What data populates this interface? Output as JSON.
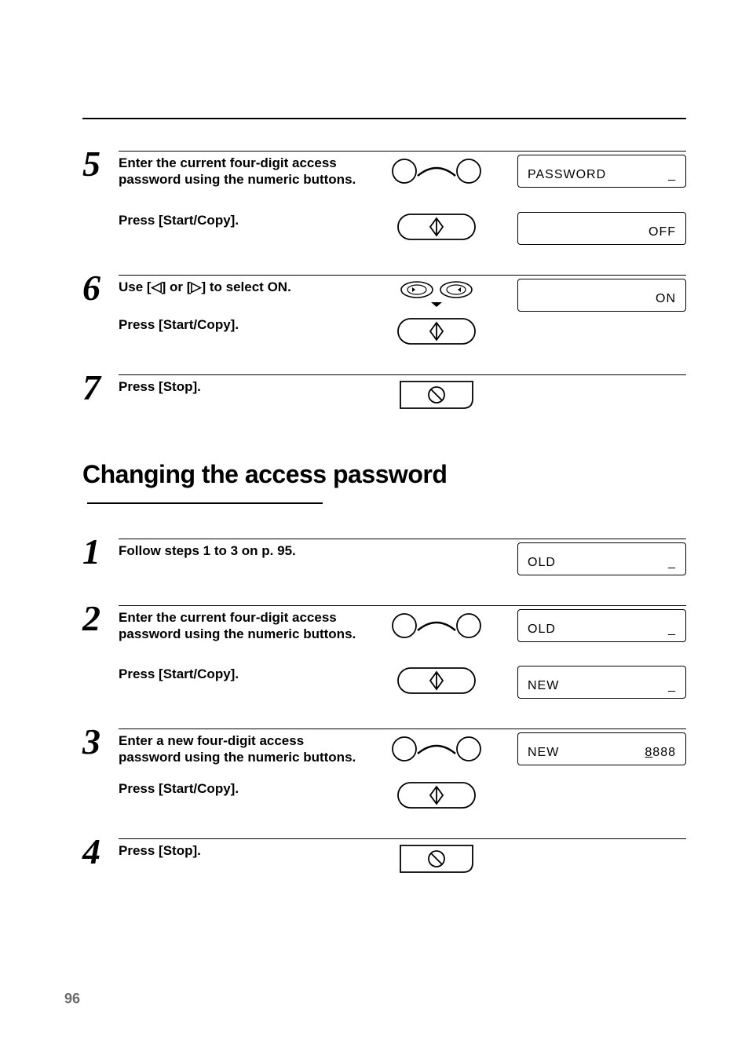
{
  "section1": {
    "step5": {
      "num": "5",
      "instr1": "Enter the current four-digit access password using the numeric buttons.",
      "disp1_left": "PASSWORD",
      "disp1_right": "_",
      "instr2": "Press [Start/Copy].",
      "disp2_right": "OFF"
    },
    "step6": {
      "num": "6",
      "instr1": "Use [◁] or [▷] to select ON.",
      "instr2": "Press [Start/Copy].",
      "disp_right": "ON"
    },
    "step7": {
      "num": "7",
      "instr": "Press [Stop]."
    }
  },
  "heading": "Changing the access password",
  "section2": {
    "step1": {
      "num": "1",
      "instr": "Follow steps 1 to 3 on p. 95.",
      "disp_left": "OLD",
      "disp_right": "_"
    },
    "step2": {
      "num": "2",
      "instr1": "Enter the current four-digit access password using the numeric  buttons.",
      "disp1_left": "OLD",
      "disp1_right": "_",
      "instr2": "Press [Start/Copy].",
      "disp2_left": "NEW",
      "disp2_right": "_"
    },
    "step3": {
      "num": "3",
      "instr1": "Enter a new four-digit access password using the numeric  buttons.",
      "disp_left": "NEW",
      "disp_right_pre": "8",
      "disp_right_post": "888",
      "instr2": "Press [Start/Copy]."
    },
    "step4": {
      "num": "4",
      "instr": "Press [Stop]."
    }
  },
  "pageNum": "96"
}
